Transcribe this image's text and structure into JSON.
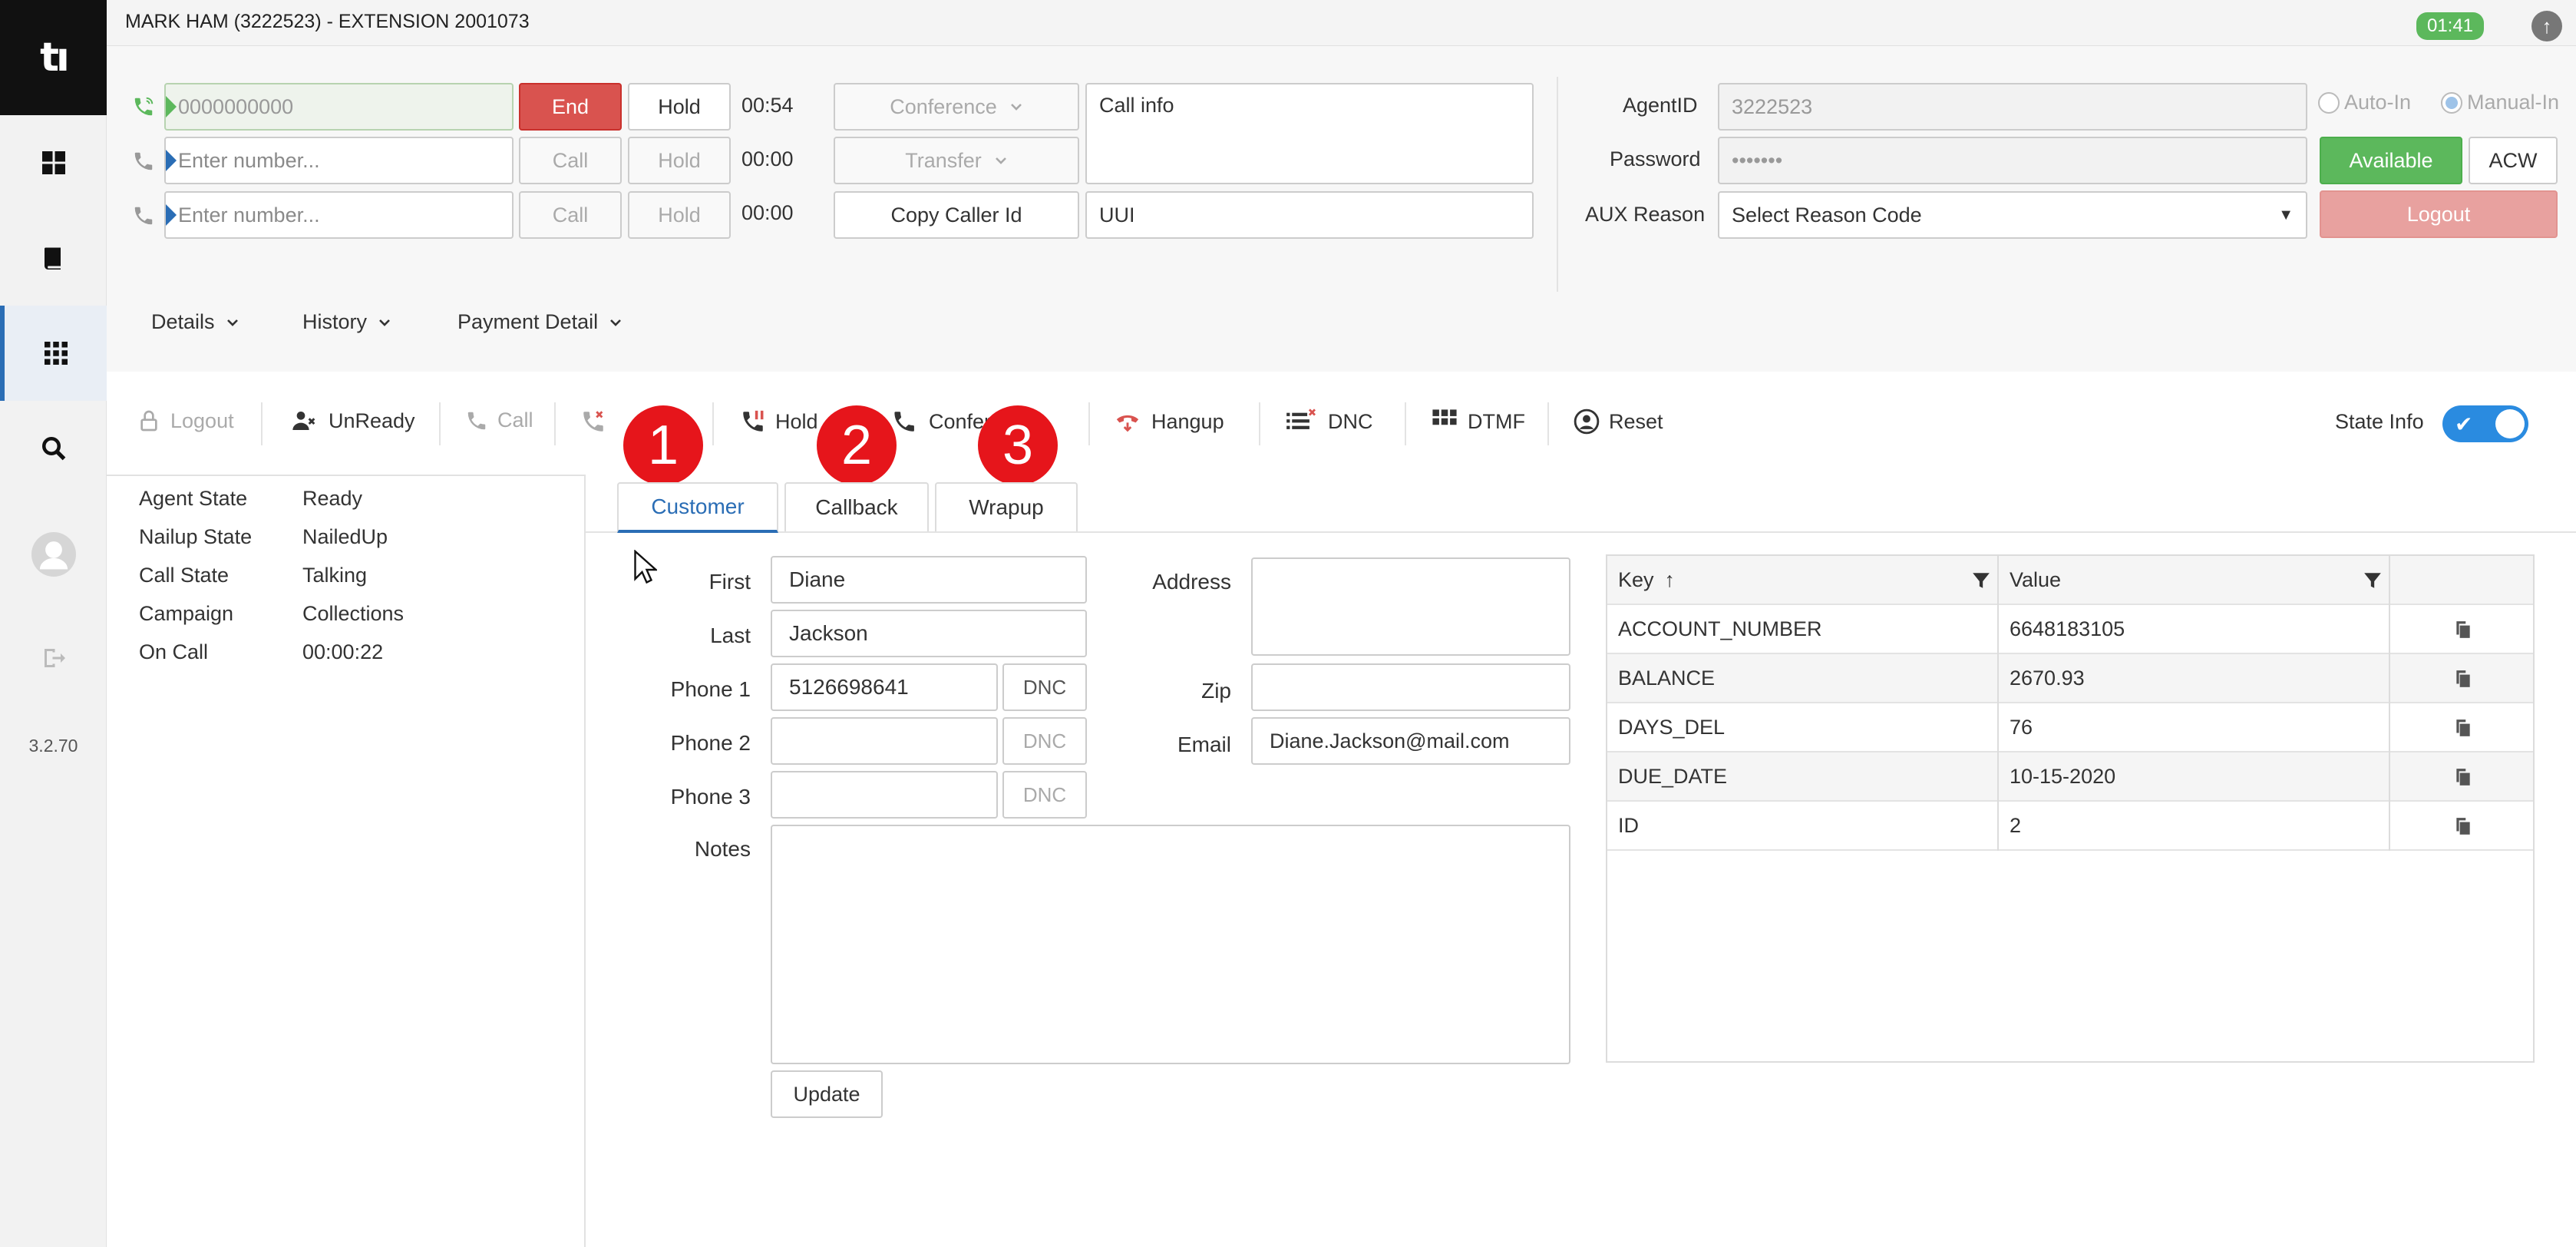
{
  "app": {
    "title": "MARK HAM (3222523) - EXTENSION 2001073",
    "timer": "01:41",
    "version": "3.2.70"
  },
  "lines": [
    {
      "number_placeholder": "0000000000",
      "action": "End",
      "hold": "Hold",
      "time": "00:54"
    },
    {
      "number_placeholder": "Enter number...",
      "action": "Call",
      "hold": "Hold",
      "time": "00:00"
    },
    {
      "number_placeholder": "Enter number...",
      "action": "Call",
      "hold": "Hold",
      "time": "00:00"
    }
  ],
  "call_actions": {
    "conference": "Conference",
    "transfer": "Transfer",
    "copy_caller_id": "Copy Caller Id"
  },
  "call_info": {
    "info_placeholder": "Call info",
    "uui_placeholder": "UUI"
  },
  "agent": {
    "agent_id_label": "AgentID",
    "agent_id_value": "3222523",
    "password_label": "Password",
    "password_value": "•••••••",
    "aux_label": "AUX Reason",
    "aux_value": "Select Reason Code",
    "auto_in": "Auto-In",
    "manual_in": "Manual-In",
    "available": "Available",
    "acw": "ACW",
    "logout": "Logout"
  },
  "menus": [
    "Details",
    "History",
    "Payment Detail"
  ],
  "toolbar": {
    "logout": "Logout",
    "unready": "UnReady",
    "call": "Call",
    "hold": "Hold",
    "conference": "Conference",
    "hangup": "Hangup",
    "dnc": "DNC",
    "dtmf": "DTMF",
    "reset": "Reset",
    "state_info": "State Info"
  },
  "badges": [
    "1",
    "2",
    "3"
  ],
  "state_info": [
    {
      "key": "Agent State",
      "value": "Ready"
    },
    {
      "key": "Nailup State",
      "value": "NailedUp"
    },
    {
      "key": "Call State",
      "value": "Talking"
    },
    {
      "key": "Campaign",
      "value": "Collections"
    },
    {
      "key": "On Call",
      "value": "00:00:22"
    }
  ],
  "tabs": [
    "Customer",
    "Callback",
    "Wrapup"
  ],
  "customer": {
    "first_label": "First",
    "first": "Diane",
    "last_label": "Last",
    "last": "Jackson",
    "phone1_label": "Phone 1",
    "phone1": "5126698641",
    "phone2_label": "Phone 2",
    "phone2": "",
    "phone3_label": "Phone 3",
    "phone3": "",
    "dnc_label": "DNC",
    "notes_label": "Notes",
    "address_label": "Address",
    "address": "",
    "zip_label": "Zip",
    "zip": "",
    "email_label": "Email",
    "email": "Diane.Jackson@mail.com",
    "update": "Update"
  },
  "grid": {
    "columns": [
      "Key",
      "Value"
    ],
    "sort_indicator": "↑",
    "rows": [
      {
        "key": "ACCOUNT_NUMBER",
        "value": "6648183105"
      },
      {
        "key": "BALANCE",
        "value": "2670.93"
      },
      {
        "key": "DAYS_DEL",
        "value": "76"
      },
      {
        "key": "DUE_DATE",
        "value": "10-15-2020"
      },
      {
        "key": "ID",
        "value": "2"
      }
    ]
  },
  "colors": {
    "accent": "#2a6db5",
    "end": "#d9534f",
    "available": "#5cb85c",
    "logout": "#e8a19f",
    "badge": "#e6151b",
    "toggle": "#2a8be0"
  }
}
